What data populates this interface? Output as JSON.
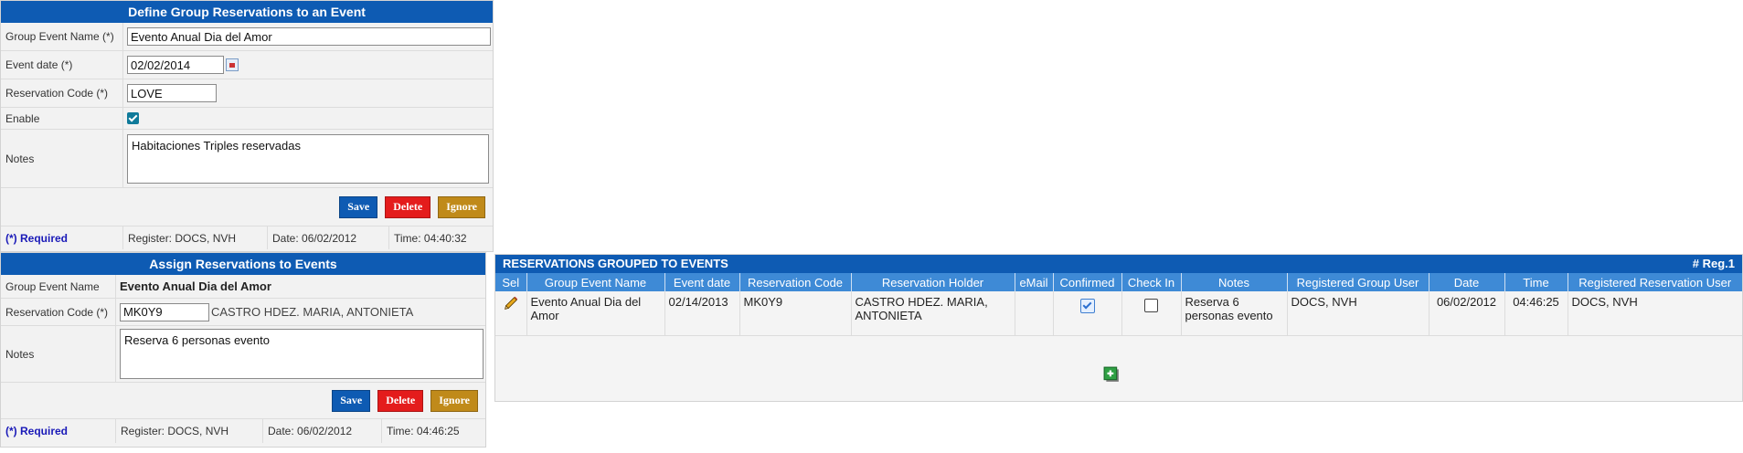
{
  "group_form": {
    "title": "Define Group Reservations to an Event",
    "name_label": "Group Event Name (*)",
    "name_value": "Evento Anual Dia del Amor",
    "date_label": "Event date (*)",
    "date_value": "02/02/2014",
    "code_label": "Reservation Code (*)",
    "code_value": "LOVE",
    "enable_label": "Enable",
    "enable_checked": true,
    "notes_label": "Notes",
    "notes_value": "Habitaciones Triples reservadas",
    "save_label": "Save",
    "delete_label": "Delete",
    "ignore_label": "Ignore",
    "required_label": "(*) Required",
    "register_label": "Register: DOCS, NVH",
    "date_footer": "Date:  06/02/2012",
    "time_footer": "Time:  04:40:32"
  },
  "assign_form": {
    "title": "Assign Reservations to Events",
    "name_label": "Group Event Name",
    "name_value": "Evento Anual Dia del Amor",
    "code_label": "Reservation Code (*)",
    "code_value": "MK0Y9",
    "holder_value": "CASTRO HDEZ. MARIA, ANTONIETA",
    "notes_label": "Notes",
    "notes_value": "Reserva 6 personas evento",
    "save_label": "Save",
    "delete_label": "Delete",
    "ignore_label": "Ignore",
    "required_label": "(*) Required",
    "register_label": "Register: DOCS, NVH",
    "date_footer": "Date: 06/02/2012",
    "time_footer": "Time: 04:46:25"
  },
  "grid": {
    "title": "RESERVATIONS GROUPED TO EVENTS",
    "reg_label": "# Reg.1",
    "columns": [
      "Sel",
      "Group Event Name",
      "Event date",
      "Reservation Code",
      "Reservation Holder",
      "eMail",
      "Confirmed",
      "Check In",
      "Notes",
      "Registered Group User",
      "Date",
      "Time",
      "Registered Reservation User"
    ],
    "row": {
      "group_event_name": "Evento Anual Dia del Amor",
      "event_date": "02/14/2013",
      "reservation_code": "MK0Y9",
      "holder": "CASTRO HDEZ. MARIA, ANTONIETA",
      "email": "",
      "confirmed": true,
      "check_in": false,
      "notes": "Reserva 6 personas evento",
      "registered_group_user": "DOCS, NVH",
      "date": "06/02/2012",
      "time": "04:46:25",
      "registered_reservation_user": "DOCS, NVH"
    }
  },
  "icons": {
    "edit": "pencil-icon",
    "add": "add-icon",
    "calendar": "calendar-icon"
  },
  "colors": {
    "header_blue": "#0e5bb3",
    "column_blue": "#3e8ad6",
    "save": "#0e5bb3",
    "delete": "#e41c1c",
    "ignore": "#c08a1a",
    "required": "#1a1ab8"
  }
}
